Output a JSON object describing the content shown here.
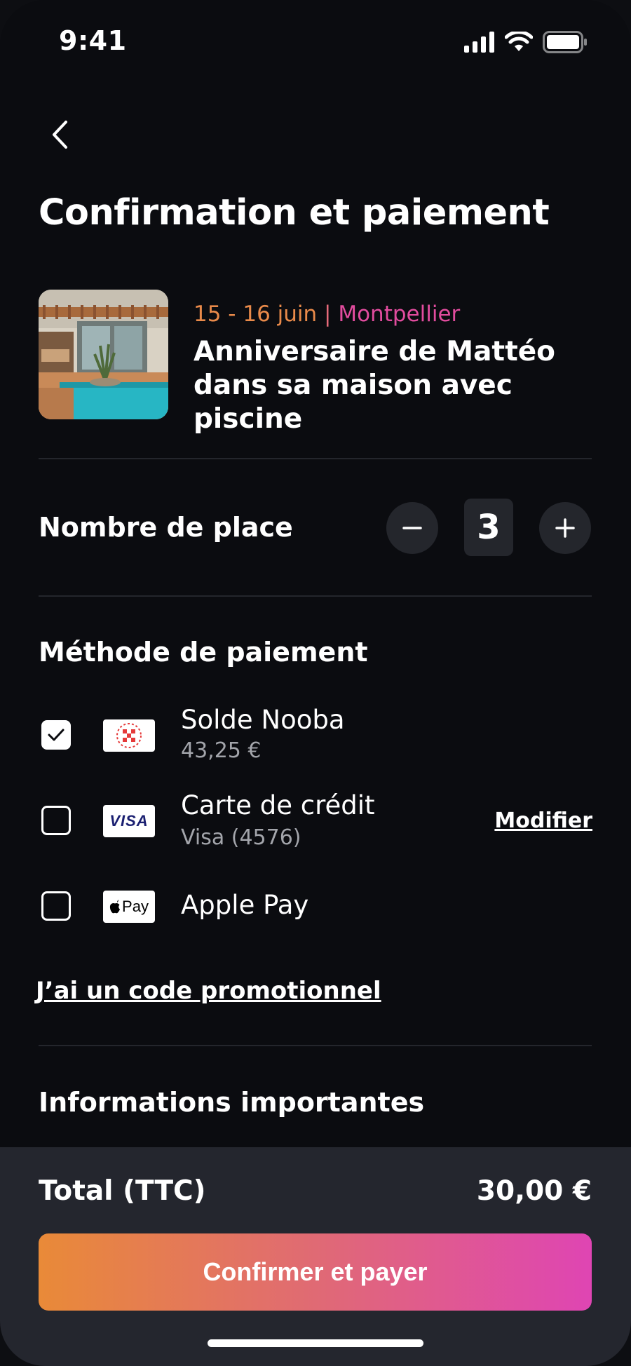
{
  "status_bar": {
    "time": "9:41"
  },
  "header": {
    "title": "Confirmation et paiement"
  },
  "event": {
    "date": "15 - 16 juin",
    "separator": "|",
    "city": "Montpellier",
    "name": "Anniversaire de Mattéo dans sa maison avec piscine"
  },
  "seats": {
    "label": "Nombre de place",
    "value": "3",
    "minus": "−",
    "plus": "+"
  },
  "payment": {
    "title": "Méthode de paiement",
    "methods": [
      {
        "name": "Solde Nooba",
        "sub": "43,25 €",
        "checked": true,
        "logo": "nooba-logo"
      },
      {
        "name": "Carte de crédit",
        "sub": "Visa (4576)",
        "checked": false,
        "logo": "visa-logo",
        "logo_text": "VISA"
      },
      {
        "name": "Apple Pay",
        "sub": "",
        "checked": false,
        "logo": "apple-pay-logo",
        "logo_text": "Pay"
      }
    ],
    "modify_label": "Modifier",
    "promo_label": "J’ai un code promotionnel"
  },
  "info": {
    "title": "Informations importantes"
  },
  "footer": {
    "total_label": "Total (TTC)",
    "total_value": "30,00 €",
    "confirm_label": "Confirmer et payer"
  },
  "colors": {
    "background": "#0b0c10",
    "panel": "#24262e",
    "accent_orange": "#e98a38",
    "accent_pink": "#df45b3",
    "visa_blue": "#1a1f71"
  }
}
